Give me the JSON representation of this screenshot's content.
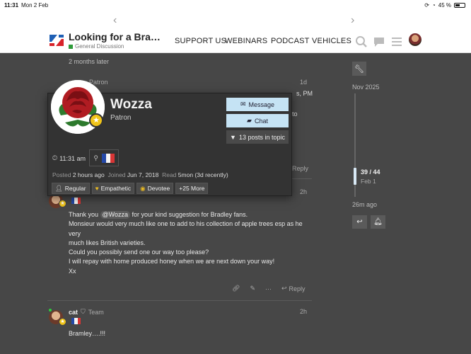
{
  "status_bar": {
    "time": "11:31",
    "date": "Mon 2 Feb",
    "battery": "45 %"
  },
  "header": {
    "title": "Looking for a Bra…",
    "category": "General Discussion",
    "category_color": "#2e9b3a",
    "nav": [
      "SUPPORT US",
      "WEBINARS",
      "PODCAST",
      "VEHICLES"
    ]
  },
  "stream": {
    "time_gap": "2 months later",
    "stub_post": {
      "author_partial": "Patron",
      "date": "1d",
      "text_partial_1": "s, PM",
      "text_partial_2": "to",
      "reply": "Reply"
    },
    "post": {
      "date": "2h",
      "mention": "@Wozza",
      "lines": [
        "Thank you ",
        " for your kind suggestion for Bradley fans.",
        "Monsieur would very much like one to add to his collection of apple trees esp as he very",
        "much likes British varieties.",
        "Could you possibly send one our way too please?",
        "I will repay with home produced honey when we are next down your way!",
        "Xx"
      ],
      "reply": "Reply"
    },
    "next_post": {
      "username": "cat",
      "group": "Team",
      "date": "2h",
      "text": "Bramley….!!!"
    }
  },
  "user_card": {
    "name": "Wozza",
    "title": "Patron",
    "message_button": "Message",
    "chat_button": "Chat",
    "posts_filter": "13 posts in topic",
    "local_time": "11:31 am",
    "meta": {
      "posted_label": "Posted",
      "posted": "2 hours ago",
      "joined_label": "Joined",
      "joined": "Jun 7, 2018",
      "read_label": "Read",
      "read": "5mon",
      "read_extra": " (3d recently)"
    },
    "badges": [
      {
        "label": "Regular",
        "icon": "user-icon"
      },
      {
        "label": "Empathetic",
        "icon": "heart-icon"
      },
      {
        "label": "Devotee",
        "icon": "eye-icon"
      },
      {
        "label": "+25 More",
        "icon": ""
      }
    ]
  },
  "timeline": {
    "start": "Nov 2025",
    "position": "39 / 44",
    "position_date": "Feb 1",
    "end": "26m ago"
  }
}
